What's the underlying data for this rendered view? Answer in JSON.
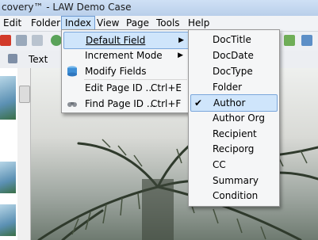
{
  "window": {
    "title": "covery™  -  LAW Demo Case"
  },
  "menubar": {
    "items": [
      {
        "label": "Edit"
      },
      {
        "label": "Folder"
      },
      {
        "label": "Index"
      },
      {
        "label": "View"
      },
      {
        "label": "Page"
      },
      {
        "label": "Tools"
      },
      {
        "label": "Help"
      }
    ]
  },
  "toolbar2": {
    "text_label": "Text"
  },
  "index_menu": {
    "items": [
      {
        "label": "Default Field",
        "shortcut": "",
        "submenu": true
      },
      {
        "label": "Increment Mode",
        "shortcut": "",
        "submenu": true
      },
      {
        "label": "Modify Fields",
        "shortcut": "",
        "submenu": false,
        "icon": "database-icon"
      },
      {
        "label": "Edit Page ID ...",
        "shortcut": "Ctrl+E",
        "submenu": false
      },
      {
        "label": "Find Page ID ...",
        "shortcut": "Ctrl+F",
        "submenu": false,
        "icon": "binoculars-icon"
      }
    ]
  },
  "field_menu": {
    "items": [
      {
        "label": "DocTitle"
      },
      {
        "label": "DocDate"
      },
      {
        "label": "DocType"
      },
      {
        "label": "Folder"
      },
      {
        "label": "Author",
        "checked": true
      },
      {
        "label": "Author Org"
      },
      {
        "label": "Recipient"
      },
      {
        "label": "Reciporg"
      },
      {
        "label": "CC"
      },
      {
        "label": "Summary"
      },
      {
        "label": "Condition"
      }
    ],
    "check_glyph": "✔"
  },
  "colors": {
    "highlight": "#cfe5fb",
    "highlight_border": "#7aa6db"
  }
}
